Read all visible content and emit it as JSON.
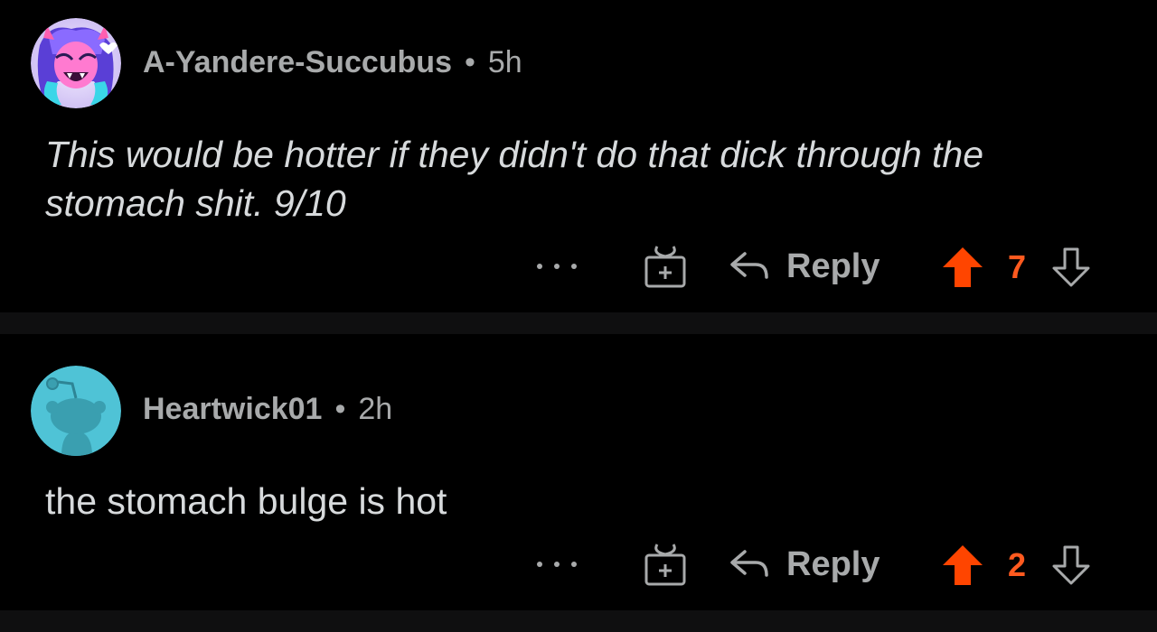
{
  "colors": {
    "background": "#000000",
    "divider": "#0f0f10",
    "text_primary": "#d7dadc",
    "text_muted": "#a8aaab",
    "upvote_active": "#ff4500",
    "score_active": "#ff5a1f",
    "avatar2_bg": "#4fc3d6"
  },
  "comments": [
    {
      "username": "A-Yandere-Succubus",
      "separator": "•",
      "time": "5h",
      "body": "This would be hotter if they didn't do that dick through the stomach shit. 9/10",
      "avatar_icon": "anime-character-avatar-icon",
      "actions": {
        "more_icon": "more-options-icon",
        "award_icon": "gift-award-icon",
        "reply_icon": "reply-arrow-icon",
        "reply_label": "Reply",
        "upvote_icon": "upvote-arrow-icon",
        "upvoted": true,
        "score": "7",
        "downvote_icon": "downvote-arrow-icon"
      }
    },
    {
      "username": "Heartwick01",
      "separator": "•",
      "time": "2h",
      "body": "the stomach bulge is hot",
      "avatar_icon": "default-snoo-avatar-icon",
      "actions": {
        "more_icon": "more-options-icon",
        "award_icon": "gift-award-icon",
        "reply_icon": "reply-arrow-icon",
        "reply_label": "Reply",
        "upvote_icon": "upvote-arrow-icon",
        "upvoted": true,
        "score": "2",
        "downvote_icon": "downvote-arrow-icon"
      }
    }
  ]
}
